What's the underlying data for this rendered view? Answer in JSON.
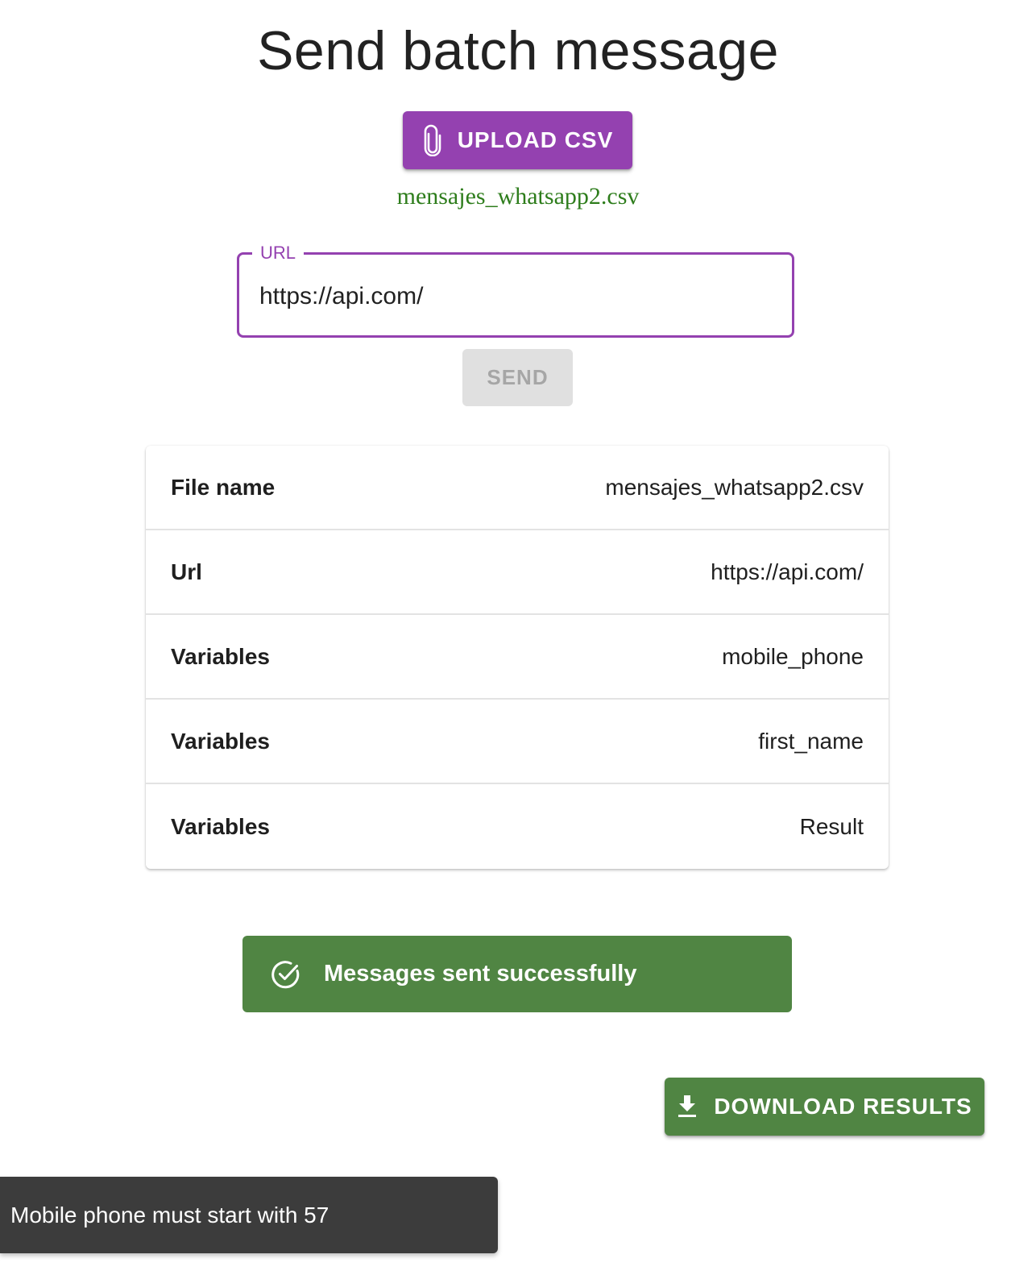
{
  "page": {
    "title": "Send batch message"
  },
  "upload": {
    "button_label": "UPLOAD CSV",
    "selected_file": "mensajes_whatsapp2.csv"
  },
  "url_field": {
    "label": "URL",
    "value": "https://api.com/"
  },
  "send": {
    "label": "SEND"
  },
  "summary": {
    "rows": [
      {
        "key": "File name",
        "value": "mensajes_whatsapp2.csv"
      },
      {
        "key": "Url",
        "value": "https://api.com/"
      },
      {
        "key": "Variables",
        "value": "mobile_phone"
      },
      {
        "key": "Variables",
        "value": "first_name"
      },
      {
        "key": "Variables",
        "value": "Result"
      }
    ]
  },
  "alert": {
    "message": "Messages sent successfully",
    "icon": "check-circle-icon"
  },
  "download": {
    "label": "DOWNLOAD RESULTS",
    "icon": "download-icon"
  },
  "snackbar": {
    "message": "Mobile phone must start with 57"
  },
  "colors": {
    "primary": "#9441b0",
    "success": "#508543",
    "filename_text": "#2e7d1c",
    "disabled_bg": "#e0e0e0",
    "snackbar_bg": "#3c3c3c"
  }
}
